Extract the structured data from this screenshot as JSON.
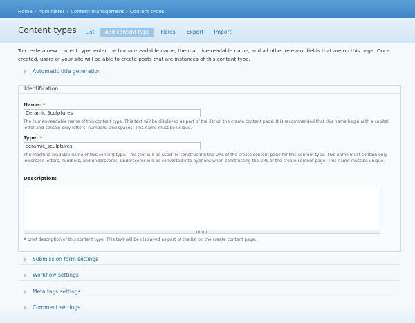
{
  "breadcrumb": [
    "Home",
    "Administer",
    "Content management",
    "Content types"
  ],
  "breadcrumb_sep": "›",
  "header": {
    "title": "Content types",
    "tabs": [
      {
        "label": "List"
      },
      {
        "label": "Add content type"
      },
      {
        "label": "Fields"
      },
      {
        "label": "Export"
      },
      {
        "label": "Import"
      }
    ]
  },
  "intro": "To create a new content type, enter the human-readable name, the machine-readable name, and all other relevant fields that are on this page. Once created, users of your site will be able to create posts that are instances of this content type.",
  "sections": {
    "auto_title": "Automatic title generation",
    "submission": "Submission form settings",
    "workflow": "Workflow settings",
    "meta_tags": "Meta tags settings",
    "comment": "Comment settings"
  },
  "identification": {
    "legend": "Identification",
    "required_mark": "*",
    "name": {
      "label": "Name:",
      "value": "Ceramic Sculptures",
      "description": "The human-readable name of this content type. This text will be displayed as part of the list on the create content page. It is recommended that this name begin with a capital letter and contain only letters, numbers, and spaces. This name must be unique."
    },
    "type": {
      "label": "Type:",
      "value": "ceramic_sculptures",
      "description": "The machine-readable name of this content type. This text will be used for constructing the URL of the create content page for this content type. This name must contain only lowercase letters, numbers, and underscores. Underscores will be converted into hyphens when constructing the URL of the create content page. This name must be unique."
    },
    "description": {
      "label": "Description:",
      "value": "",
      "help": "A brief description of this content type. This text will be displayed as part of the list on the create content page."
    }
  }
}
